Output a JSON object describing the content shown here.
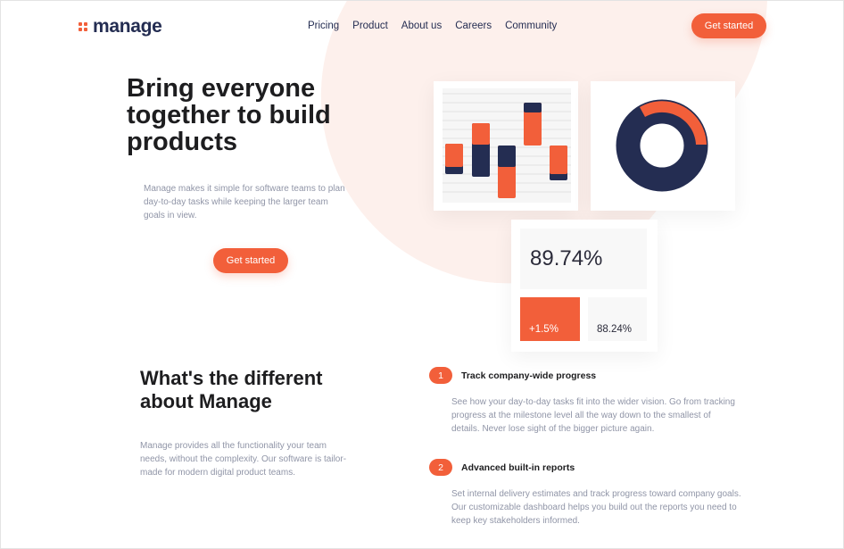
{
  "logo": {
    "name": "manage"
  },
  "nav": [
    "Pricing",
    "Product",
    "About us",
    "Careers",
    "Community"
  ],
  "header": {
    "cta_label": "Get started"
  },
  "hero": {
    "title": "Bring everyone together to build products",
    "text": "Manage makes it simple for software teams to plan day-to-day tasks while keeping the larger team goals in view.",
    "cta_label": "Get started"
  },
  "stats": {
    "main": "89.74%",
    "change": "+1.5%",
    "secondary": "88.24%"
  },
  "donut": {
    "navy_fraction": 0.72,
    "orange_fraction": 0.28
  },
  "section": {
    "title": "What's the different about Manage",
    "text": "Manage provides all the functionality your team needs, without the complexity. Our software is tailor-made for modern digital product teams."
  },
  "features": [
    {
      "number": "1",
      "title": "Track company-wide progress",
      "text": "See how your day-to-day tasks fit into the wider vision. Go from tracking progress at the milestone level all the way down to the smallest of details. Never lose sight of the bigger picture again."
    },
    {
      "number": "2",
      "title": "Advanced built-in reports",
      "text": "Set internal delivery estimates and track progress toward company goals. Our customizable dashboard helps you build out the reports you need to keep key stakeholders informed."
    }
  ],
  "colors": {
    "accent": "#f25f3a",
    "navy": "#242d52",
    "muted": "#9095a7",
    "tint": "#fdf0ec"
  }
}
